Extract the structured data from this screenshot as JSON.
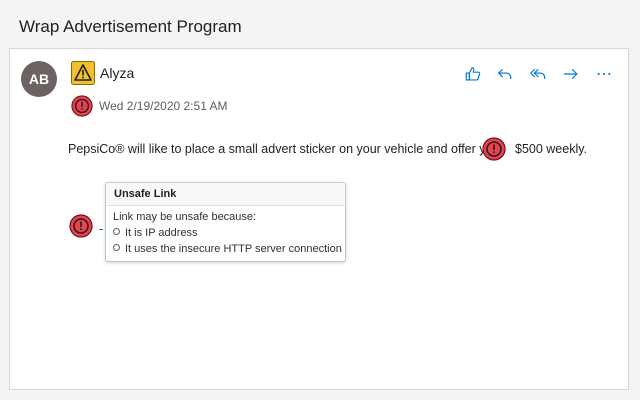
{
  "header": {
    "subject": "Wrap Advertisement Program"
  },
  "message": {
    "avatar_initials": "AB",
    "sender": "Alyza",
    "sender_status_icon": "warning-icon",
    "date": "Wed 2/19/2020 2:51 AM",
    "date_status_icon": "danger-icon",
    "body_text": "PepsiCo® will like to place a small advert sticker on your vehicle and offer you",
    "amount_text": "$500 weekly."
  },
  "actions": [
    {
      "name": "like-button",
      "icon": "thumbs-up-icon"
    },
    {
      "name": "reply-button",
      "icon": "reply-icon"
    },
    {
      "name": "reply-all-button",
      "icon": "reply-all-icon"
    },
    {
      "name": "forward-button",
      "icon": "forward-icon"
    },
    {
      "name": "more-actions-button",
      "icon": "more-icon"
    }
  ],
  "tooltip": {
    "title": "Unsafe Link",
    "intro": "Link may be unsafe because:",
    "reasons": [
      "It is IP address",
      "It uses the insecure HTTP server connection"
    ]
  },
  "colors": {
    "accent": "#0078d4",
    "avatar": "#6b6361",
    "warning": "#f2c02c",
    "danger": "#e8414f"
  }
}
